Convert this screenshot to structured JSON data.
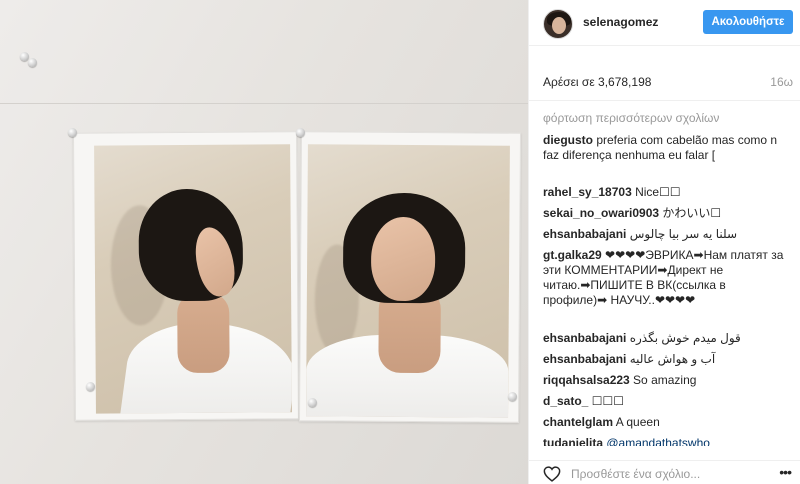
{
  "header": {
    "username": "selenagomez",
    "follow_label": "Ακολουθήστε"
  },
  "post": {
    "likes": "Αρέσει σε 3,678,198",
    "time_ago": "16ω"
  },
  "comments": {
    "load_more": "φόρτωση περισσότερων σχολίων",
    "items": [
      {
        "author": "diegusto",
        "text": " preferia com cabelão mas como n faz diferença nenhuma eu falar ["
      },
      {
        "author": "rahel_sy_18703",
        "text": " Nice☐☐"
      },
      {
        "author": "sekai_no_owari0903",
        "text": " かわいい☐"
      },
      {
        "author": "ehsanbabajani",
        "text": " سلنا یه سر بیا چالوس"
      },
      {
        "author": "gt.galka29",
        "text": " ❤❤❤❤ЭВРИКА➡Нам платят за эти КОММЕНТАРИИ➡Директ не читаю.➡ПИШИТЕ В ВК(ссылка в профиле)➡ НАУЧУ..❤❤❤❤"
      },
      {
        "author": "ehsanbabajani",
        "text": " قول میدم خوش بگذره"
      },
      {
        "author": "ehsanbabajani",
        "text": " آب و هواش عالیه"
      },
      {
        "author": "riqqahsalsa223",
        "text": " So amazing"
      },
      {
        "author": "d_sato_",
        "text": " ☐☐☐"
      },
      {
        "author": "chantelglam",
        "text": " A queen"
      },
      {
        "author": "tudanielita",
        "text": " ",
        "mention": "@amandathatswho"
      }
    ]
  },
  "footer": {
    "comment_placeholder": "Προσθέστε ένα σχόλιο...",
    "more_label": "•••"
  },
  "colors": {
    "accent": "#3897f0",
    "text": "#262626",
    "muted": "#999999",
    "mention": "#003569"
  },
  "icons": {
    "like": "heart-icon",
    "more": "more-options-icon"
  }
}
